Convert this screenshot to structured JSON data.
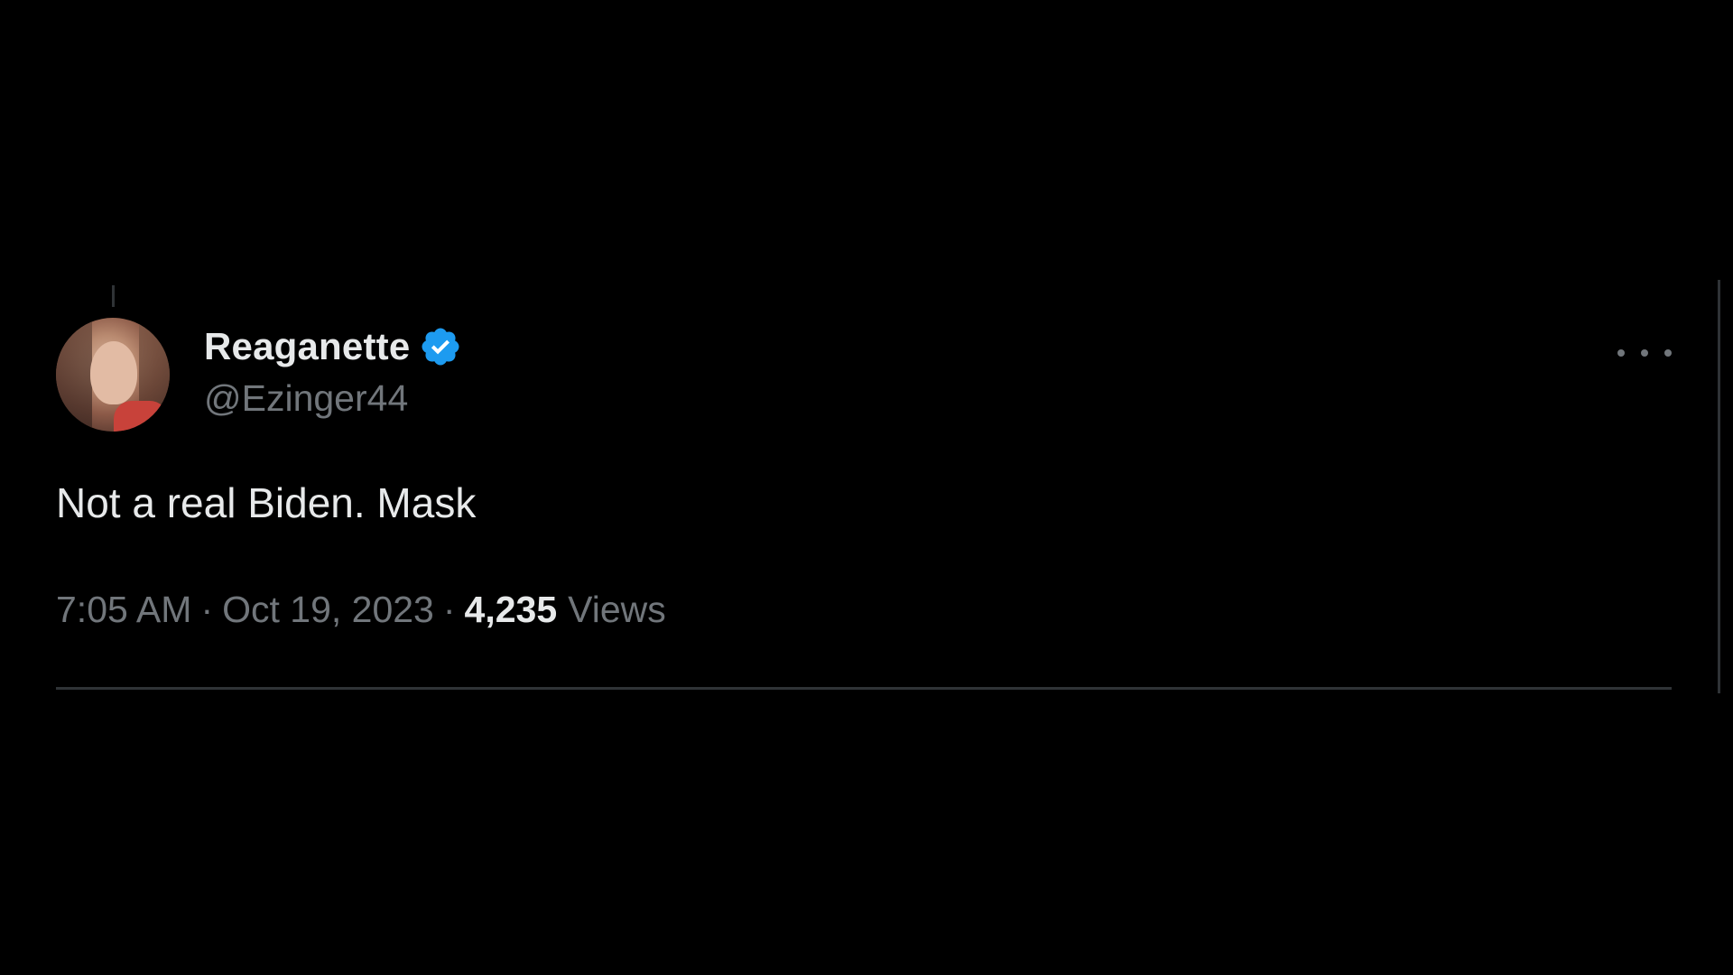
{
  "tweet": {
    "author": {
      "display_name": "Reaganette",
      "handle": "@Ezinger44",
      "verified": true
    },
    "text": "Not a real Biden. Mask",
    "time": "7:05 AM",
    "separator": "·",
    "date": "Oct 19, 2023",
    "views_count": "4,235",
    "views_label": "Views"
  },
  "icons": {
    "verified": "verified-badge-icon",
    "more": "more-options-icon"
  },
  "colors": {
    "background": "#000000",
    "primary_text": "#e7e9ea",
    "secondary_text": "#71767b",
    "verified_blue": "#1d9bf0",
    "divider": "#2f3336"
  }
}
